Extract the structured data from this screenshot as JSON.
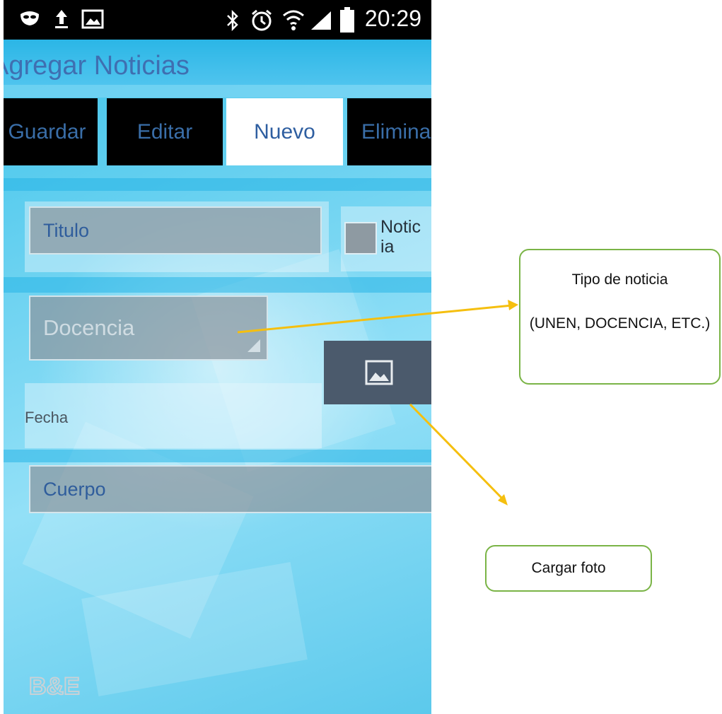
{
  "status_bar": {
    "time": "20:29",
    "left_icons": [
      "mask-icon",
      "upload-icon",
      "image-icon"
    ],
    "right_icons": [
      "bluetooth-icon",
      "alarm-icon",
      "wifi-icon",
      "signal-icon",
      "battery-icon"
    ]
  },
  "app": {
    "title": "Agregar Noticias",
    "tabs": [
      {
        "label": "Guardar",
        "active": false
      },
      {
        "label": "Editar",
        "active": false
      },
      {
        "label": "Nuevo",
        "active": true
      },
      {
        "label": "Eliminar",
        "active": false
      }
    ]
  },
  "form": {
    "titulo_placeholder": "Titulo",
    "checkbox_label_line1": "Notic",
    "checkbox_label_line2": "ia",
    "tipo_value": "Docencia",
    "fecha_label": "Fecha",
    "cuerpo_placeholder": "Cuerpo"
  },
  "logo_text": "B&E",
  "annotations": {
    "tipo_title": "Tipo de noticia",
    "tipo_detail": "(UNEN, DOCENCIA, ETC.)",
    "foto": "Cargar foto"
  },
  "colors": {
    "annotation_border": "#7ab446",
    "arrow": "#f5bf0f",
    "tab_active_bg": "#ffffff",
    "tab_bg": "#000000"
  }
}
